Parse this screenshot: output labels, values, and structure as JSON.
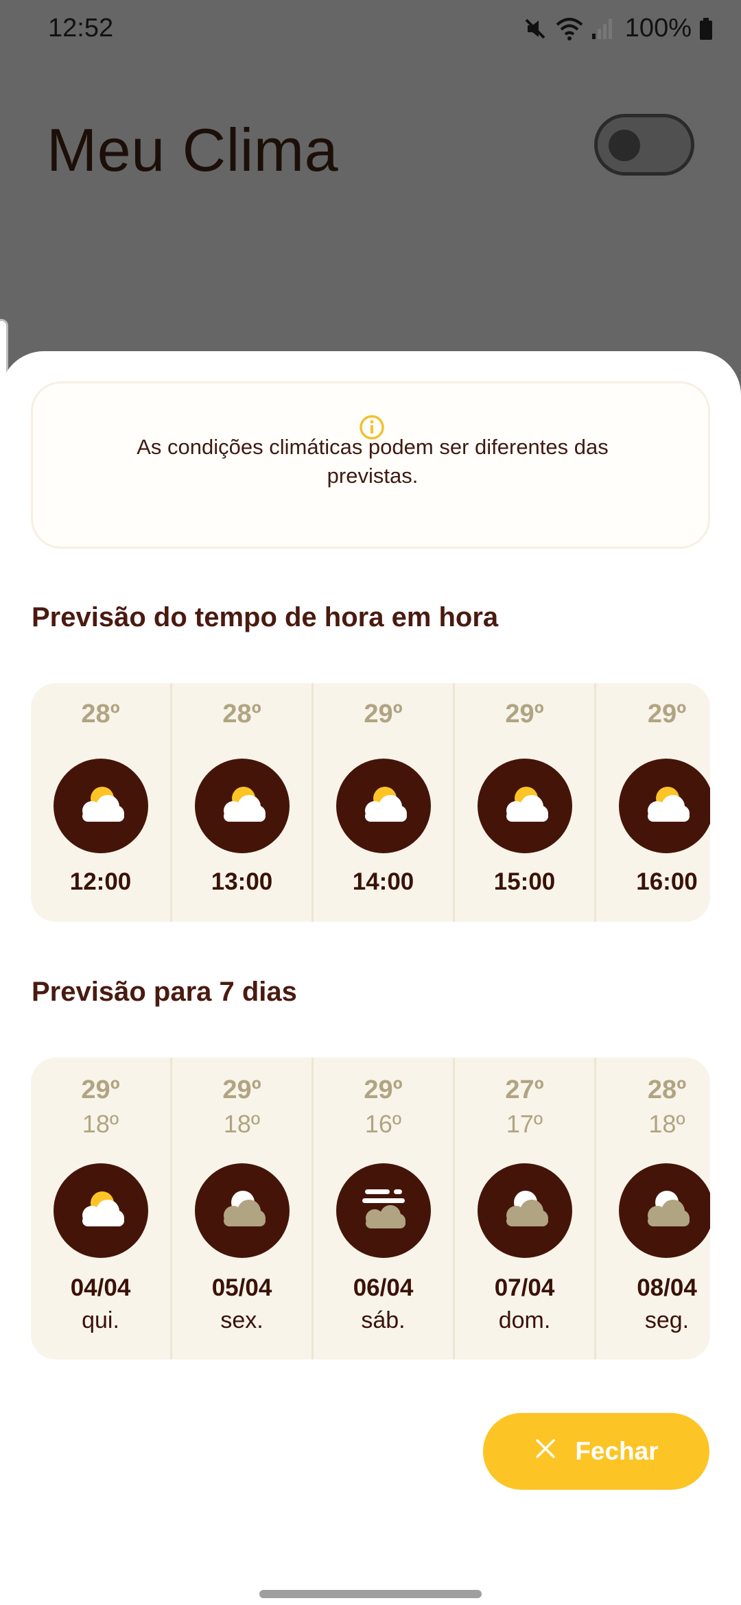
{
  "status_bar": {
    "time": "12:52",
    "battery": "100%",
    "icons": [
      "mute-icon",
      "wifi-icon",
      "signal-icon",
      "battery-icon"
    ]
  },
  "app": {
    "title": "Meu Clima",
    "toggle_state": "off"
  },
  "info": {
    "icon": "info-icon",
    "text": "As condições climáticas podem ser diferentes das previstas."
  },
  "hourly": {
    "title": "Previsão do tempo de hora em hora",
    "items": [
      {
        "temp": "28º",
        "time": "12:00",
        "icon": "partly-cloudy-icon"
      },
      {
        "temp": "28º",
        "time": "13:00",
        "icon": "partly-cloudy-icon"
      },
      {
        "temp": "29º",
        "time": "14:00",
        "icon": "partly-cloudy-icon"
      },
      {
        "temp": "29º",
        "time": "15:00",
        "icon": "partly-cloudy-icon"
      },
      {
        "temp": "29º",
        "time": "16:00",
        "icon": "partly-cloudy-icon"
      }
    ]
  },
  "daily": {
    "title": "Previsão para 7 dias",
    "items": [
      {
        "high": "29º",
        "low": "18º",
        "date": "04/04",
        "day": "qui.",
        "icon": "partly-cloudy-icon"
      },
      {
        "high": "29º",
        "low": "18º",
        "date": "05/04",
        "day": "sex.",
        "icon": "cloudy-icon"
      },
      {
        "high": "29º",
        "low": "16º",
        "date": "06/04",
        "day": "sáb.",
        "icon": "fog-cloud-icon"
      },
      {
        "high": "27º",
        "low": "17º",
        "date": "07/04",
        "day": "dom.",
        "icon": "cloudy-icon"
      },
      {
        "high": "28º",
        "low": "18º",
        "date": "08/04",
        "day": "seg.",
        "icon": "cloudy-icon"
      }
    ]
  },
  "close_button": {
    "label": "Fechar",
    "icon": "close-icon"
  },
  "colors": {
    "accent": "#fcc425",
    "icon_bg": "#451408",
    "text_dark": "#3a1208",
    "temp_muted": "#b0a482",
    "strip_bg": "#f8f4ea"
  }
}
